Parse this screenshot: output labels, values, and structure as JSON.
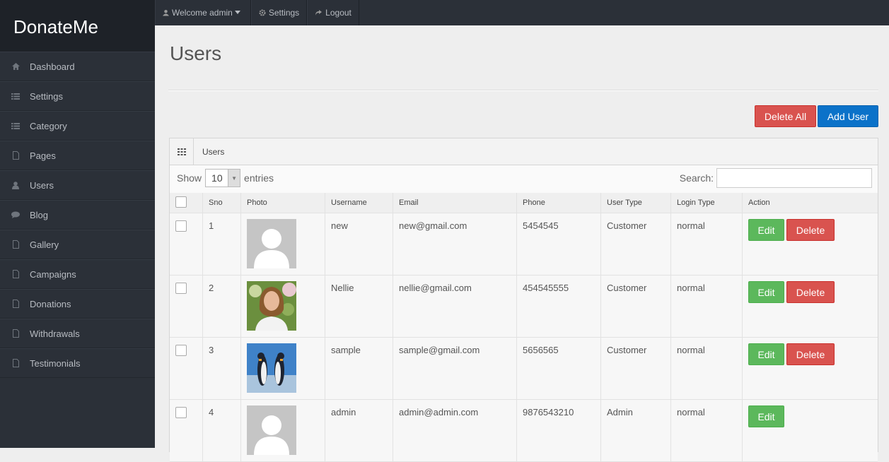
{
  "app": {
    "brand": "DonateMe"
  },
  "sidebar": {
    "items": [
      {
        "label": "Dashboard",
        "icon": "home-icon"
      },
      {
        "label": "Settings",
        "icon": "list-icon"
      },
      {
        "label": "Category",
        "icon": "list-icon"
      },
      {
        "label": "Pages",
        "icon": "file-icon"
      },
      {
        "label": "Users",
        "icon": "user-icon"
      },
      {
        "label": "Blog",
        "icon": "comment-icon"
      },
      {
        "label": "Gallery",
        "icon": "file-icon"
      },
      {
        "label": "Campaigns",
        "icon": "file-icon"
      },
      {
        "label": "Donations",
        "icon": "file-icon"
      },
      {
        "label": "Withdrawals",
        "icon": "file-icon"
      },
      {
        "label": "Testimonials",
        "icon": "file-icon"
      }
    ]
  },
  "topbar": {
    "welcome": "Welcome admin",
    "settings": "Settings",
    "logout": "Logout"
  },
  "page": {
    "title": "Users"
  },
  "actions": {
    "delete_all": "Delete All",
    "add_user": "Add User"
  },
  "panel": {
    "title": "Users",
    "show_label": "Show",
    "entries_value": "10",
    "entries_label": "entries",
    "search_label": "Search:",
    "search_value": ""
  },
  "table": {
    "columns": [
      "Sno",
      "Photo",
      "Username",
      "Email",
      "Phone",
      "User Type",
      "Login Type",
      "Action"
    ],
    "rows": [
      {
        "sno": "1",
        "photo": "placeholder",
        "username": "new",
        "email": "new@gmail.com",
        "phone": "5454545",
        "user_type": "Customer",
        "login_type": "normal",
        "edit": "Edit",
        "delete": "Delete"
      },
      {
        "sno": "2",
        "photo": "woman",
        "username": "Nellie",
        "email": "nellie@gmail.com",
        "phone": "454545555",
        "user_type": "Customer",
        "login_type": "normal",
        "edit": "Edit",
        "delete": "Delete"
      },
      {
        "sno": "3",
        "photo": "penguins",
        "username": "sample",
        "email": "sample@gmail.com",
        "phone": "5656565",
        "user_type": "Customer",
        "login_type": "normal",
        "edit": "Edit",
        "delete": "Delete"
      },
      {
        "sno": "4",
        "photo": "placeholder",
        "username": "admin",
        "email": "admin@admin.com",
        "phone": "9876543210",
        "user_type": "Admin",
        "login_type": "normal",
        "edit": "Edit",
        "delete": ""
      }
    ]
  },
  "colors": {
    "sidebar": "#2b3038",
    "danger": "#d9534f",
    "primary": "#0b72c9",
    "success": "#5cb85c"
  }
}
